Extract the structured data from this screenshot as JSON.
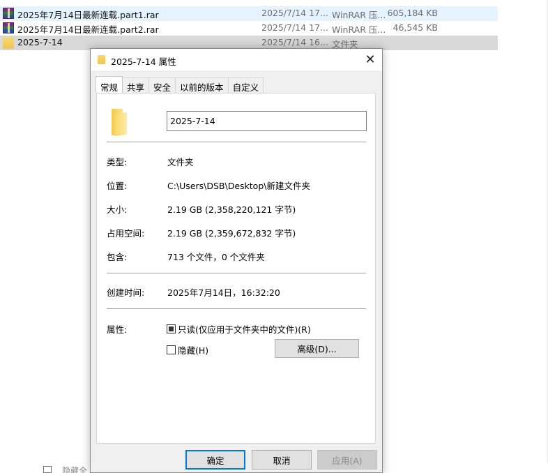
{
  "files": [
    {
      "name": "2025年7月14日最新连载.part1.rar",
      "date": "2025/7/14 17...",
      "type": "WinRAR 压...",
      "size": "605,184 KB",
      "icon": "winrar-archive-icon"
    },
    {
      "name": "2025年7月14日最新连载.part2.rar",
      "date": "2025/7/14 17...",
      "type": "WinRAR 压...",
      "size": "46,545 KB",
      "icon": "winrar-archive-icon"
    },
    {
      "name": "2025-7-14",
      "date": "2025/7/14 16...",
      "type": "文件夹",
      "size": "",
      "icon": "folder-icon"
    }
  ],
  "background_peek": {
    "text": "隐藏全"
  },
  "dialog": {
    "title": "2025-7-14 属性",
    "close_glyph": "✕",
    "tabs": [
      "常规",
      "共享",
      "安全",
      "以前的版本",
      "自定义"
    ],
    "active_tab": "常规",
    "folder_name": "2025-7-14",
    "properties": {
      "type_label": "类型:",
      "type_value": "文件夹",
      "location_label": "位置:",
      "location_value": "C:\\Users\\DSB\\Desktop\\新建文件夹",
      "size_label": "大小:",
      "size_value": "2.19 GB (2,358,220,121 字节)",
      "size_on_disk_label": "占用空间:",
      "size_on_disk_value": "2.19 GB (2,359,672,832 字节)",
      "contains_label": "包含:",
      "contains_value": "713 个文件，0 个文件夹",
      "created_label": "创建时间:",
      "created_value": "2025年7月14日，16:32:20",
      "attributes_label": "属性:"
    },
    "attributes": {
      "readonly_label": "只读(仅应用于文件夹中的文件)(R)",
      "readonly_state": "indeterminate",
      "hidden_label": "隐藏(H)",
      "hidden_state": "unchecked",
      "advanced_label": "高级(D)..."
    },
    "buttons": {
      "ok": "确定",
      "cancel": "取消",
      "apply": "应用(A)"
    },
    "colors": {
      "accent": "#0078d7",
      "dialog_bg": "#f0f0f0",
      "hover_row": "#e5f3ff",
      "selected_row": "#d9d9d9"
    }
  }
}
